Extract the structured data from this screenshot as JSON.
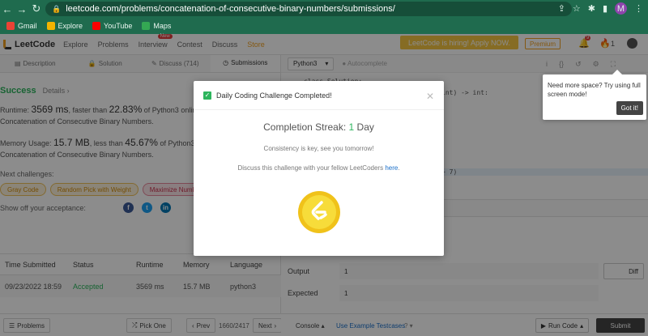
{
  "browser": {
    "url": "leetcode.com/problems/concatenation-of-consecutive-binary-numbers/submissions/",
    "profile_initial": "M",
    "bookmarks": [
      {
        "label": "Gmail",
        "color": "#ea4335"
      },
      {
        "label": "Explore",
        "color": "#f4b400"
      },
      {
        "label": "YouTube",
        "color": "#ff0000"
      },
      {
        "label": "Maps",
        "color": "#34a853"
      }
    ]
  },
  "topnav": {
    "logo": "LeetCode",
    "items": [
      "Explore",
      "Problems",
      "Interview",
      "Contest",
      "Discuss",
      "Store"
    ],
    "new_badge": "New",
    "hiring": "LeetCode is hiring! Apply NOW.",
    "premium": "Premium",
    "notifications": "9",
    "streak_count": "1"
  },
  "left": {
    "tabs": [
      "Description",
      "Solution",
      "Discuss (714)",
      "Submissions"
    ],
    "success": "Success",
    "details": "Details",
    "runtime": {
      "prefix": "Runtime: ",
      "value": "3569 ms",
      "mid": ", faster than ",
      "pct": "22.83%",
      "suffix": " of Python3 online submissions for Concatenation of Consecutive Binary Numbers."
    },
    "memory": {
      "prefix": "Memory Usage: ",
      "value": "15.7 MB",
      "mid": ", less than ",
      "pct": "45.67%",
      "suffix": " of Python3 online submissions for Concatenation of Consecutive Binary Numbers."
    },
    "next_label": "Next challenges:",
    "challenges": [
      {
        "label": "Gray Code",
        "level": "medium"
      },
      {
        "label": "Random Pick with Weight",
        "level": "medium"
      },
      {
        "label": "Maximize Number of Nice Divisors",
        "level": "hard"
      }
    ],
    "share_label": "Show off your acceptance:",
    "table": {
      "headers": [
        "Time Submitted",
        "Status",
        "Runtime",
        "Memory",
        "Language"
      ],
      "rows": [
        [
          "09/23/2022 18:59",
          "Accepted",
          "3569 ms",
          "15.7 MB",
          "python3"
        ]
      ]
    },
    "footer": {
      "problems": "Problems",
      "pick_one": "Pick One",
      "prev": "Prev",
      "page": "1660/2417",
      "next": "Next"
    }
  },
  "right": {
    "language": "Python3",
    "autocomplete": "Autocomplete",
    "code_fragments": [
      "class Solution:",
      "int) -> int:",
      "+ 7)"
    ],
    "output_label": "Output",
    "output_value": "1",
    "expected_label": "Expected",
    "expected_value": "1",
    "diff": "Diff",
    "console": "Console",
    "example": "Use Example Testcases",
    "run": "Run Code",
    "submit": "Submit"
  },
  "modal": {
    "title": "Daily Coding Challenge Completed!",
    "streak_label": "Completion Streak: ",
    "streak_value": "1",
    "streak_unit": " Day",
    "consistency": "Consistency is key, see you tomorrow!",
    "discuss_text": "Discuss this challenge with your fellow LeetCoders ",
    "discuss_link": "here",
    "coin_color": "#f5d21a"
  },
  "tooltip": {
    "text": "Need more space? Try using full screen mode!",
    "button": "Got it!"
  }
}
